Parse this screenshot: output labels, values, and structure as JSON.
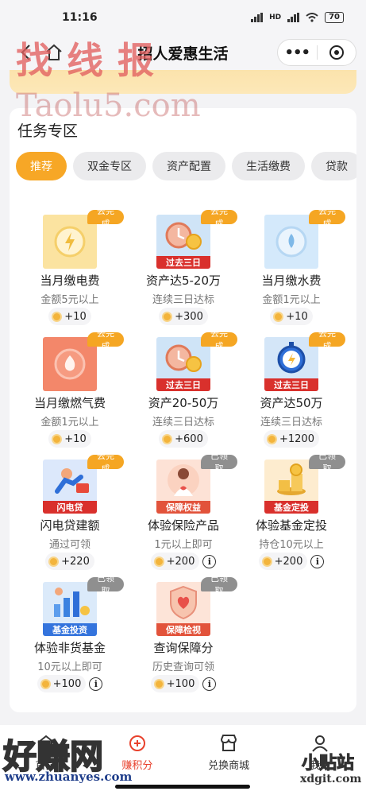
{
  "status_bar": {
    "time": "11:16",
    "network": "HD",
    "battery": "70"
  },
  "nav": {
    "title": "招人爱惠生活",
    "more": "•••"
  },
  "section": {
    "title": "任务专区"
  },
  "tabs": [
    {
      "label": "推荐",
      "active": true
    },
    {
      "label": "双金专区",
      "active": false
    },
    {
      "label": "资产配置",
      "active": false
    },
    {
      "label": "生活缴费",
      "active": false
    },
    {
      "label": "贷款",
      "active": false
    }
  ],
  "tasks": [
    {
      "title": "当月缴电费",
      "subtitle": "金额5元以上",
      "reward": "+10",
      "badge": "去完成",
      "ribbon": ""
    },
    {
      "title": "资产达5-20万",
      "subtitle": "连续三日达标",
      "reward": "+300",
      "badge": "去完成",
      "ribbon": "过去三日"
    },
    {
      "title": "当月缴水费",
      "subtitle": "金额1元以上",
      "reward": "+10",
      "badge": "去完成",
      "ribbon": ""
    },
    {
      "title": "当月缴燃气费",
      "subtitle": "金额1元以上",
      "reward": "+10",
      "badge": "去完成",
      "ribbon": ""
    },
    {
      "title": "资产20-50万",
      "subtitle": "连续三日达标",
      "reward": "+600",
      "badge": "去完成",
      "ribbon": "过去三日"
    },
    {
      "title": "资产达50万",
      "subtitle": "连续三日达标",
      "reward": "+1200",
      "badge": "去完成",
      "ribbon": "过去三日"
    },
    {
      "title": "闪电贷建额",
      "subtitle": "通过可领",
      "reward": "+220",
      "badge": "去完成",
      "ribbon": "闪电贷"
    },
    {
      "title": "体验保险产品",
      "subtitle": "1元以上即可",
      "reward": "+200",
      "badge": "已领取",
      "ribbon": "保障权益"
    },
    {
      "title": "体验基金定投",
      "subtitle": "持仓10元以上",
      "reward": "+200",
      "badge": "已领取",
      "ribbon": "基金定投"
    },
    {
      "title": "体验非货基金",
      "subtitle": "10元以上即可",
      "reward": "+100",
      "badge": "已领取",
      "ribbon": "基金投资"
    },
    {
      "title": "查询保障分",
      "subtitle": "历史查询可领",
      "reward": "+100",
      "badge": "已领取",
      "ribbon": "保障检视"
    }
  ],
  "info_symbol": "i",
  "bottom_nav": [
    {
      "label": "首页"
    },
    {
      "label": "赚积分"
    },
    {
      "label": "兑换商城"
    },
    {
      "label": "我的"
    }
  ],
  "watermarks": {
    "top": "找线报",
    "url": "Taolu5.com",
    "bottom_left": "好赚网",
    "bottom_left_url": "www.zhuanyes.com",
    "bottom_right": "小贴站",
    "bottom_right_url": "xdgit.com"
  },
  "colors": {
    "accent": "#f7a726",
    "badge_todo": "#f5a623",
    "badge_done": "#8f8f8f",
    "ribbon": "#d9302c",
    "active_nav": "#e8412c"
  }
}
